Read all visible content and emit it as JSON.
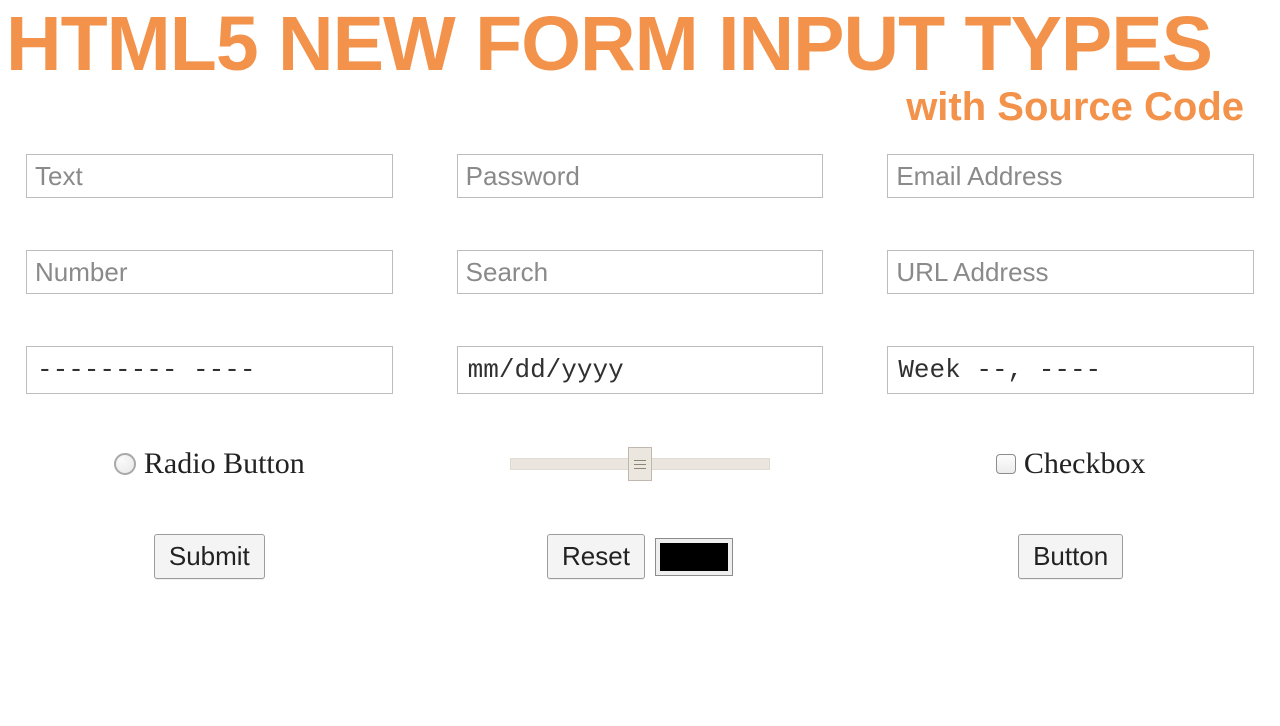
{
  "header": {
    "title": "HTML5 NEW FORM INPUT TYPES",
    "subtitle": "with Source Code"
  },
  "inputs": {
    "text_placeholder": "Text",
    "password_placeholder": "Password",
    "email_placeholder": "Email Address",
    "number_placeholder": "Number",
    "search_placeholder": "Search",
    "url_placeholder": "URL Address",
    "datetime_local_value": "--------- ----",
    "date_value": "mm/dd/yyyy",
    "week_value": "Week --, ----"
  },
  "controls": {
    "radio_label": "Radio Button",
    "checkbox_label": "Checkbox",
    "range_value": 50,
    "range_min": 0,
    "range_max": 100,
    "color_value": "#000000"
  },
  "buttons": {
    "submit": "Submit",
    "reset": "Reset",
    "button": "Button"
  }
}
